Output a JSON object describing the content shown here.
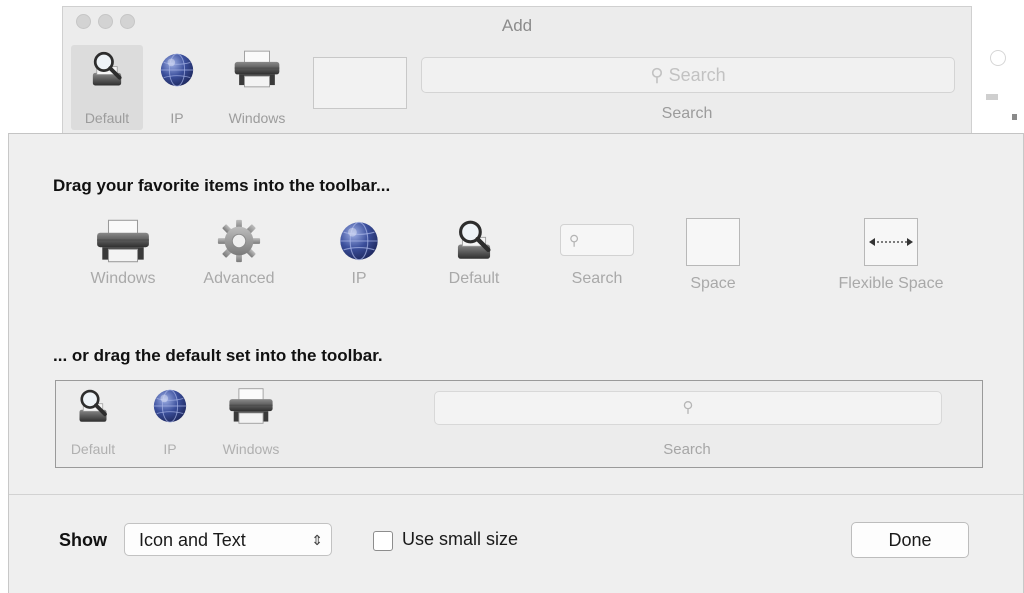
{
  "window": {
    "title": "Add",
    "toolbar": {
      "items": [
        {
          "label": "Default",
          "icon": "default-printer-icon"
        },
        {
          "label": "IP",
          "icon": "globe-icon"
        },
        {
          "label": "Windows",
          "icon": "printer-icon"
        }
      ],
      "search_placeholder": "Search",
      "search_label": "Search"
    }
  },
  "sheet": {
    "palette_heading": "Drag your favorite items into the toolbar...",
    "palette_items": [
      {
        "label": "Windows",
        "icon": "printer-icon"
      },
      {
        "label": "Advanced",
        "icon": "gear-icon"
      },
      {
        "label": "IP",
        "icon": "globe-icon"
      },
      {
        "label": "Default",
        "icon": "default-printer-icon"
      },
      {
        "label": "Search",
        "icon": "search-icon"
      },
      {
        "label": "Space",
        "icon": "space-icon"
      },
      {
        "label": "Flexible Space",
        "icon": "flexible-space-icon"
      }
    ],
    "default_heading": "... or drag the default set into the toolbar.",
    "default_set": {
      "items": [
        {
          "label": "Default",
          "icon": "default-printer-icon"
        },
        {
          "label": "IP",
          "icon": "globe-icon"
        },
        {
          "label": "Windows",
          "icon": "printer-icon"
        }
      ],
      "search_label": "Search"
    },
    "footer": {
      "show_label": "Show",
      "show_value": "Icon and Text",
      "small_size_label": "Use small size",
      "small_size_checked": false,
      "done_label": "Done"
    }
  },
  "colors": {
    "sheet_bg": "#efefef",
    "window_bg": "#ececec",
    "label_gray": "#a9a9a9"
  }
}
